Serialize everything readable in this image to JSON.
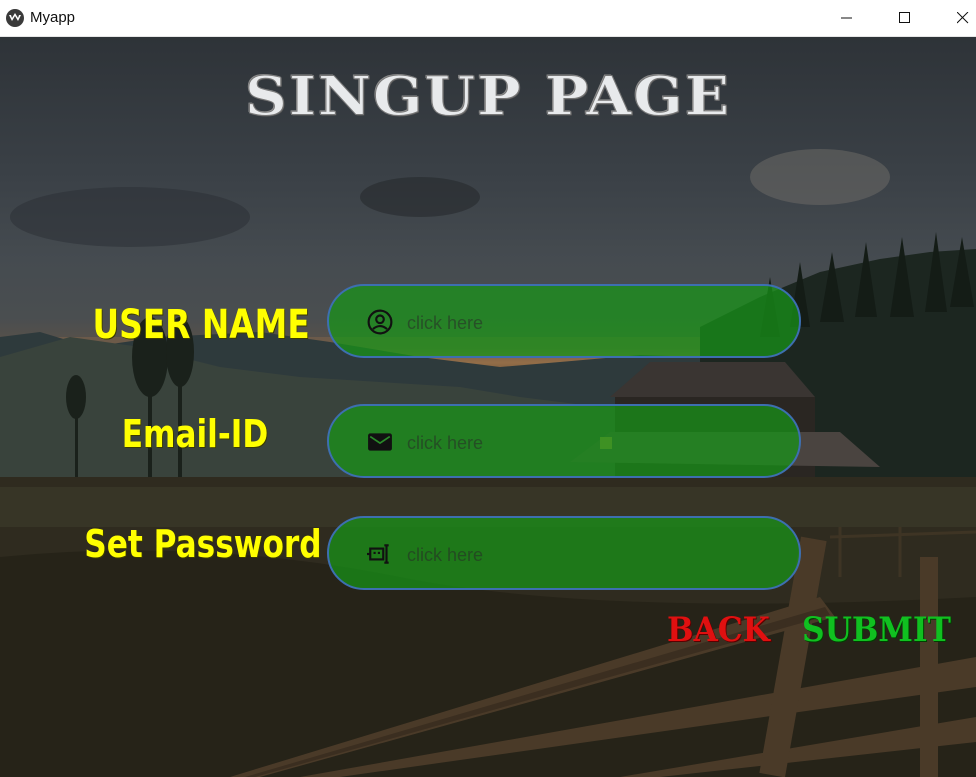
{
  "window": {
    "title": "Myapp",
    "controls": [
      "minimize",
      "maximize",
      "close"
    ]
  },
  "page": {
    "heading": "SINGUP PAGE"
  },
  "form": {
    "username": {
      "label": "USER NAME",
      "placeholder": "click here",
      "value": "",
      "icon": "account-circle-icon"
    },
    "email": {
      "label": "Email-ID",
      "placeholder": "click here",
      "value": "",
      "icon": "email-icon"
    },
    "password": {
      "label": "Set Password",
      "placeholder": "click here",
      "value": "",
      "icon": "form-textbox-password-icon"
    }
  },
  "actions": {
    "back_label": "BACK",
    "submit_label": "SUBMIT"
  },
  "colors": {
    "label": "#ffff00",
    "field": "#18961a",
    "field_border": "#3d6fb0",
    "back": "#e01010",
    "submit": "#10c020"
  }
}
